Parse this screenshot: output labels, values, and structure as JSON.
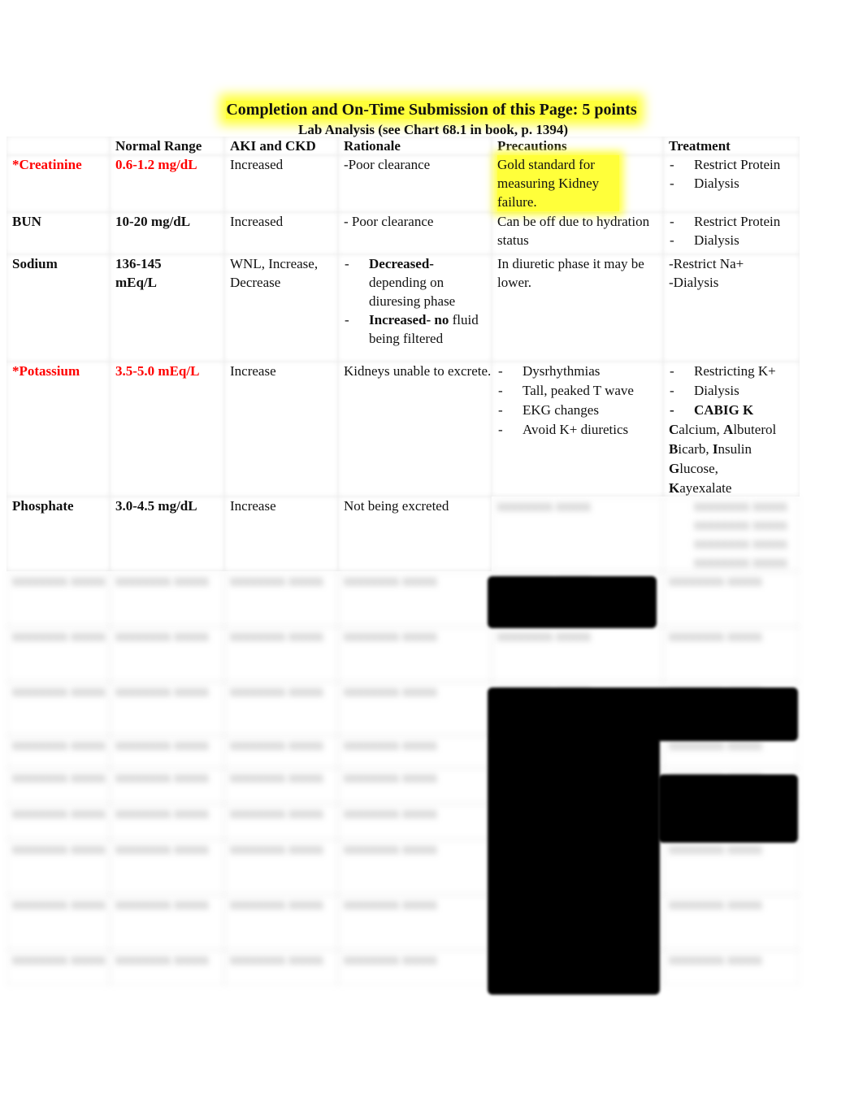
{
  "header": {
    "title": "Completion and On-Time Submission of this Page: 5 points",
    "subtitle": "Lab Analysis (see Chart 68.1 in book, p. 1394)"
  },
  "table": {
    "columns": [
      "",
      "Normal Range",
      "AKI and CKD",
      "Rationale",
      "Precautions",
      "Treatment"
    ],
    "rows": [
      {
        "lab": "*Creatinine",
        "range": "0.6-1.2 mg/dL",
        "aki": "Increased",
        "rationale": "-Poor clearance",
        "precautions": "Gold standard for measuring Kidney failure.",
        "treatment": [
          "Restrict Protein",
          "Dialysis"
        ],
        "highlight_color": "#ff0000"
      },
      {
        "lab": "BUN",
        "range": "10-20 mg/dL",
        "aki": "Increased",
        "rationale": "- Poor clearance",
        "precautions": "Can be off due to hydration status",
        "treatment": [
          "Restrict Protein",
          "Dialysis"
        ]
      },
      {
        "lab": "Sodium",
        "range": "136-145 mEq/L",
        "aki": "WNL, Increase, Decrease",
        "rationale": [
          {
            "bold": "Decreased-",
            "text": " depending on diuresing phase"
          },
          {
            "bold": "Increased- no",
            "text": " fluid being filtered"
          }
        ],
        "precautions": "In diuretic phase it may be lower.",
        "treatment": [
          "-Restrict Na+",
          "-Dialysis"
        ]
      },
      {
        "lab": "*Potassium",
        "range": "3.5-5.0 mEq/L",
        "aki": "Increase",
        "rationale": "Kidneys unable to excrete.",
        "precautions": [
          "Dysrhythmias",
          "Tall, peaked T wave",
          "EKG changes",
          "Avoid K+ diuretics"
        ],
        "treatment": [
          "Restricting K+",
          "Dialysis",
          "CABIG K"
        ],
        "mnemonic": [
          {
            "b": "C",
            "t": "alcium, "
          },
          {
            "b": "A",
            "t": "lbuterol"
          },
          {
            "b": "B",
            "t": "icarb, "
          },
          {
            "b": "I",
            "t": "nsulin"
          },
          {
            "b": "G",
            "t": "lucose,"
          },
          {
            "b": "K",
            "t": "ayexalate"
          }
        ],
        "highlight_color": "#ff0000"
      },
      {
        "lab": "Phosphate",
        "range": "3.0-4.5 mg/dL",
        "aki": "Increase",
        "rationale": "Not being excreted",
        "precautions": "(blurred)",
        "treatment": [
          "(blurred)"
        ]
      }
    ],
    "obscured_rows_count": 10,
    "obscured_placeholder": "xxxxxxxx xxxxx"
  }
}
